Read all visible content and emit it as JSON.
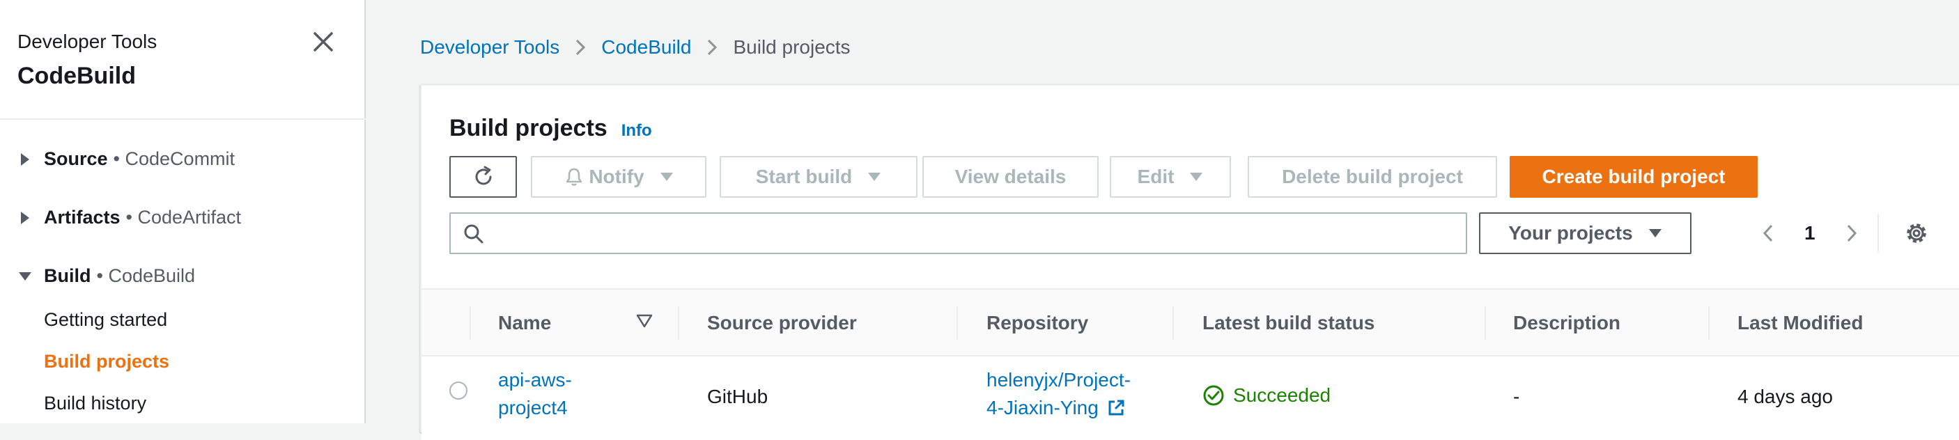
{
  "sidebar": {
    "service": "Developer Tools",
    "title": "CodeBuild",
    "groups": [
      {
        "name": "Source",
        "sub": "• CodeCommit",
        "expanded": false
      },
      {
        "name": "Artifacts",
        "sub": "• CodeArtifact",
        "expanded": false
      },
      {
        "name": "Build",
        "sub": "• CodeBuild",
        "expanded": true
      }
    ],
    "links": [
      {
        "label": "Getting started",
        "active": false
      },
      {
        "label": "Build projects",
        "active": true
      },
      {
        "label": "Build history",
        "active": false
      }
    ]
  },
  "breadcrumb": [
    "Developer Tools",
    "CodeBuild",
    "Build projects"
  ],
  "panel": {
    "title": "Build projects",
    "info": "Info",
    "toolbar": {
      "notify": "Notify",
      "start_build": "Start build",
      "view_details": "View details",
      "edit": "Edit",
      "delete": "Delete build project",
      "create": "Create build project"
    },
    "search": {
      "value": "",
      "placeholder": ""
    },
    "filter": "Your projects",
    "page": "1"
  },
  "table": {
    "columns": [
      "Name",
      "Source provider",
      "Repository",
      "Latest build status",
      "Description",
      "Last Modified"
    ],
    "rows": [
      {
        "name_line1": "api-aws-",
        "name_line2": "project4",
        "source_provider": "GitHub",
        "repo_line1": "helenyjx/Project-",
        "repo_line2": "4-Jiaxin-Ying",
        "status": "Succeeded",
        "description": "-",
        "last_modified": "4 days ago"
      }
    ]
  },
  "colors": {
    "accent": "#ec7211",
    "link": "#0073bb",
    "success": "#1d8102",
    "disabled": "#aab7b8"
  }
}
